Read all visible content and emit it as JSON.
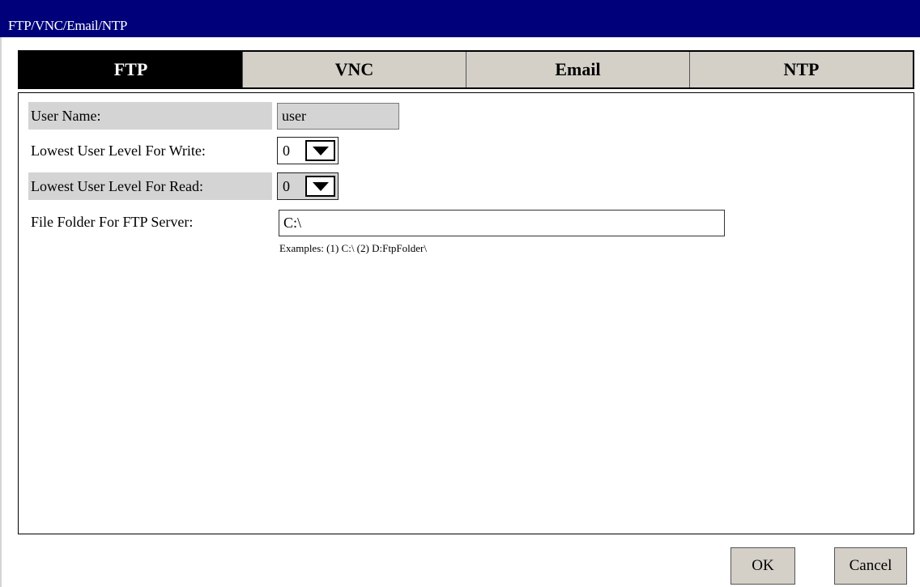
{
  "window": {
    "title": "FTP/VNC/Email/NTP"
  },
  "tabs": [
    {
      "label": "FTP",
      "active": true
    },
    {
      "label": "VNC",
      "active": false
    },
    {
      "label": "Email",
      "active": false
    },
    {
      "label": "NTP",
      "active": false
    }
  ],
  "ftp": {
    "user_name": {
      "label": "User Name:",
      "value": "user"
    },
    "write_level": {
      "label": "Lowest User Level For Write:",
      "value": "0"
    },
    "read_level": {
      "label": "Lowest User Level For Read:",
      "value": "0"
    },
    "folder": {
      "label": "File Folder For FTP Server:",
      "value": "C:\\",
      "hint": "Examples:  (1) C:\\   (2) D:FtpFolder\\"
    }
  },
  "buttons": {
    "ok": "OK",
    "cancel": "Cancel"
  },
  "icons": {
    "dropdown": "chevron-down-icon"
  },
  "colors": {
    "titlebar": "#00007b",
    "active_tab": "#000000",
    "inactive_tab": "#d4d0c8",
    "shade": "#d4d4d4"
  }
}
